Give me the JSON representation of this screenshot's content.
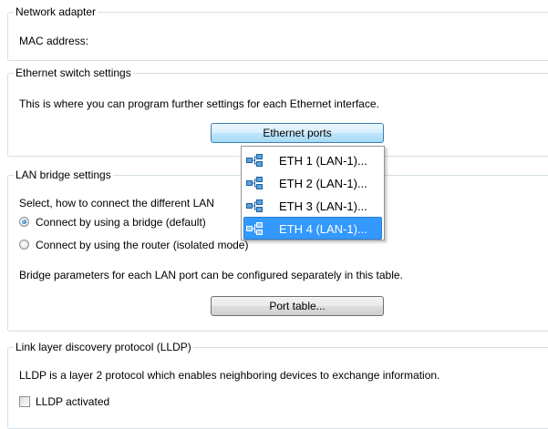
{
  "network_adapter": {
    "legend": "Network adapter",
    "mac_label": "MAC address:"
  },
  "ethernet_switch": {
    "legend": "Ethernet switch settings",
    "description": "This is where you can program further settings for each Ethernet interface.",
    "ports_button": "Ethernet ports"
  },
  "port_menu": {
    "items": [
      {
        "label": "ETH 1 (LAN-1)...",
        "icon": "network-port-icon"
      },
      {
        "label": "ETH 2 (LAN-1)...",
        "icon": "network-port-icon"
      },
      {
        "label": "ETH 3 (LAN-1)...",
        "icon": "network-port-icon"
      },
      {
        "label": "ETH 4 (LAN-1)...",
        "icon": "network-port-icon",
        "selected": true
      }
    ]
  },
  "lan_bridge": {
    "legend": "LAN bridge settings",
    "select_text": "Select, how to connect the different LAN",
    "options": [
      {
        "label": "Connect by using a bridge (default)",
        "checked": true
      },
      {
        "label": "Connect by using the router (isolated mode)",
        "checked": false
      }
    ],
    "bridge_params_text": "Bridge parameters for each LAN port can be configured separately in this table.",
    "port_table_button": "Port table..."
  },
  "lldp": {
    "legend": "Link layer discovery protocol (LLDP)",
    "description": "LLDP is a layer 2 protocol which enables neighboring devices to exchange information.",
    "checkbox_label": "LLDP activated",
    "checked": false
  },
  "colors": {
    "selection": "#3399ff",
    "group_border": "#d5dfe5",
    "radio_dot": "#1a5ea8"
  }
}
